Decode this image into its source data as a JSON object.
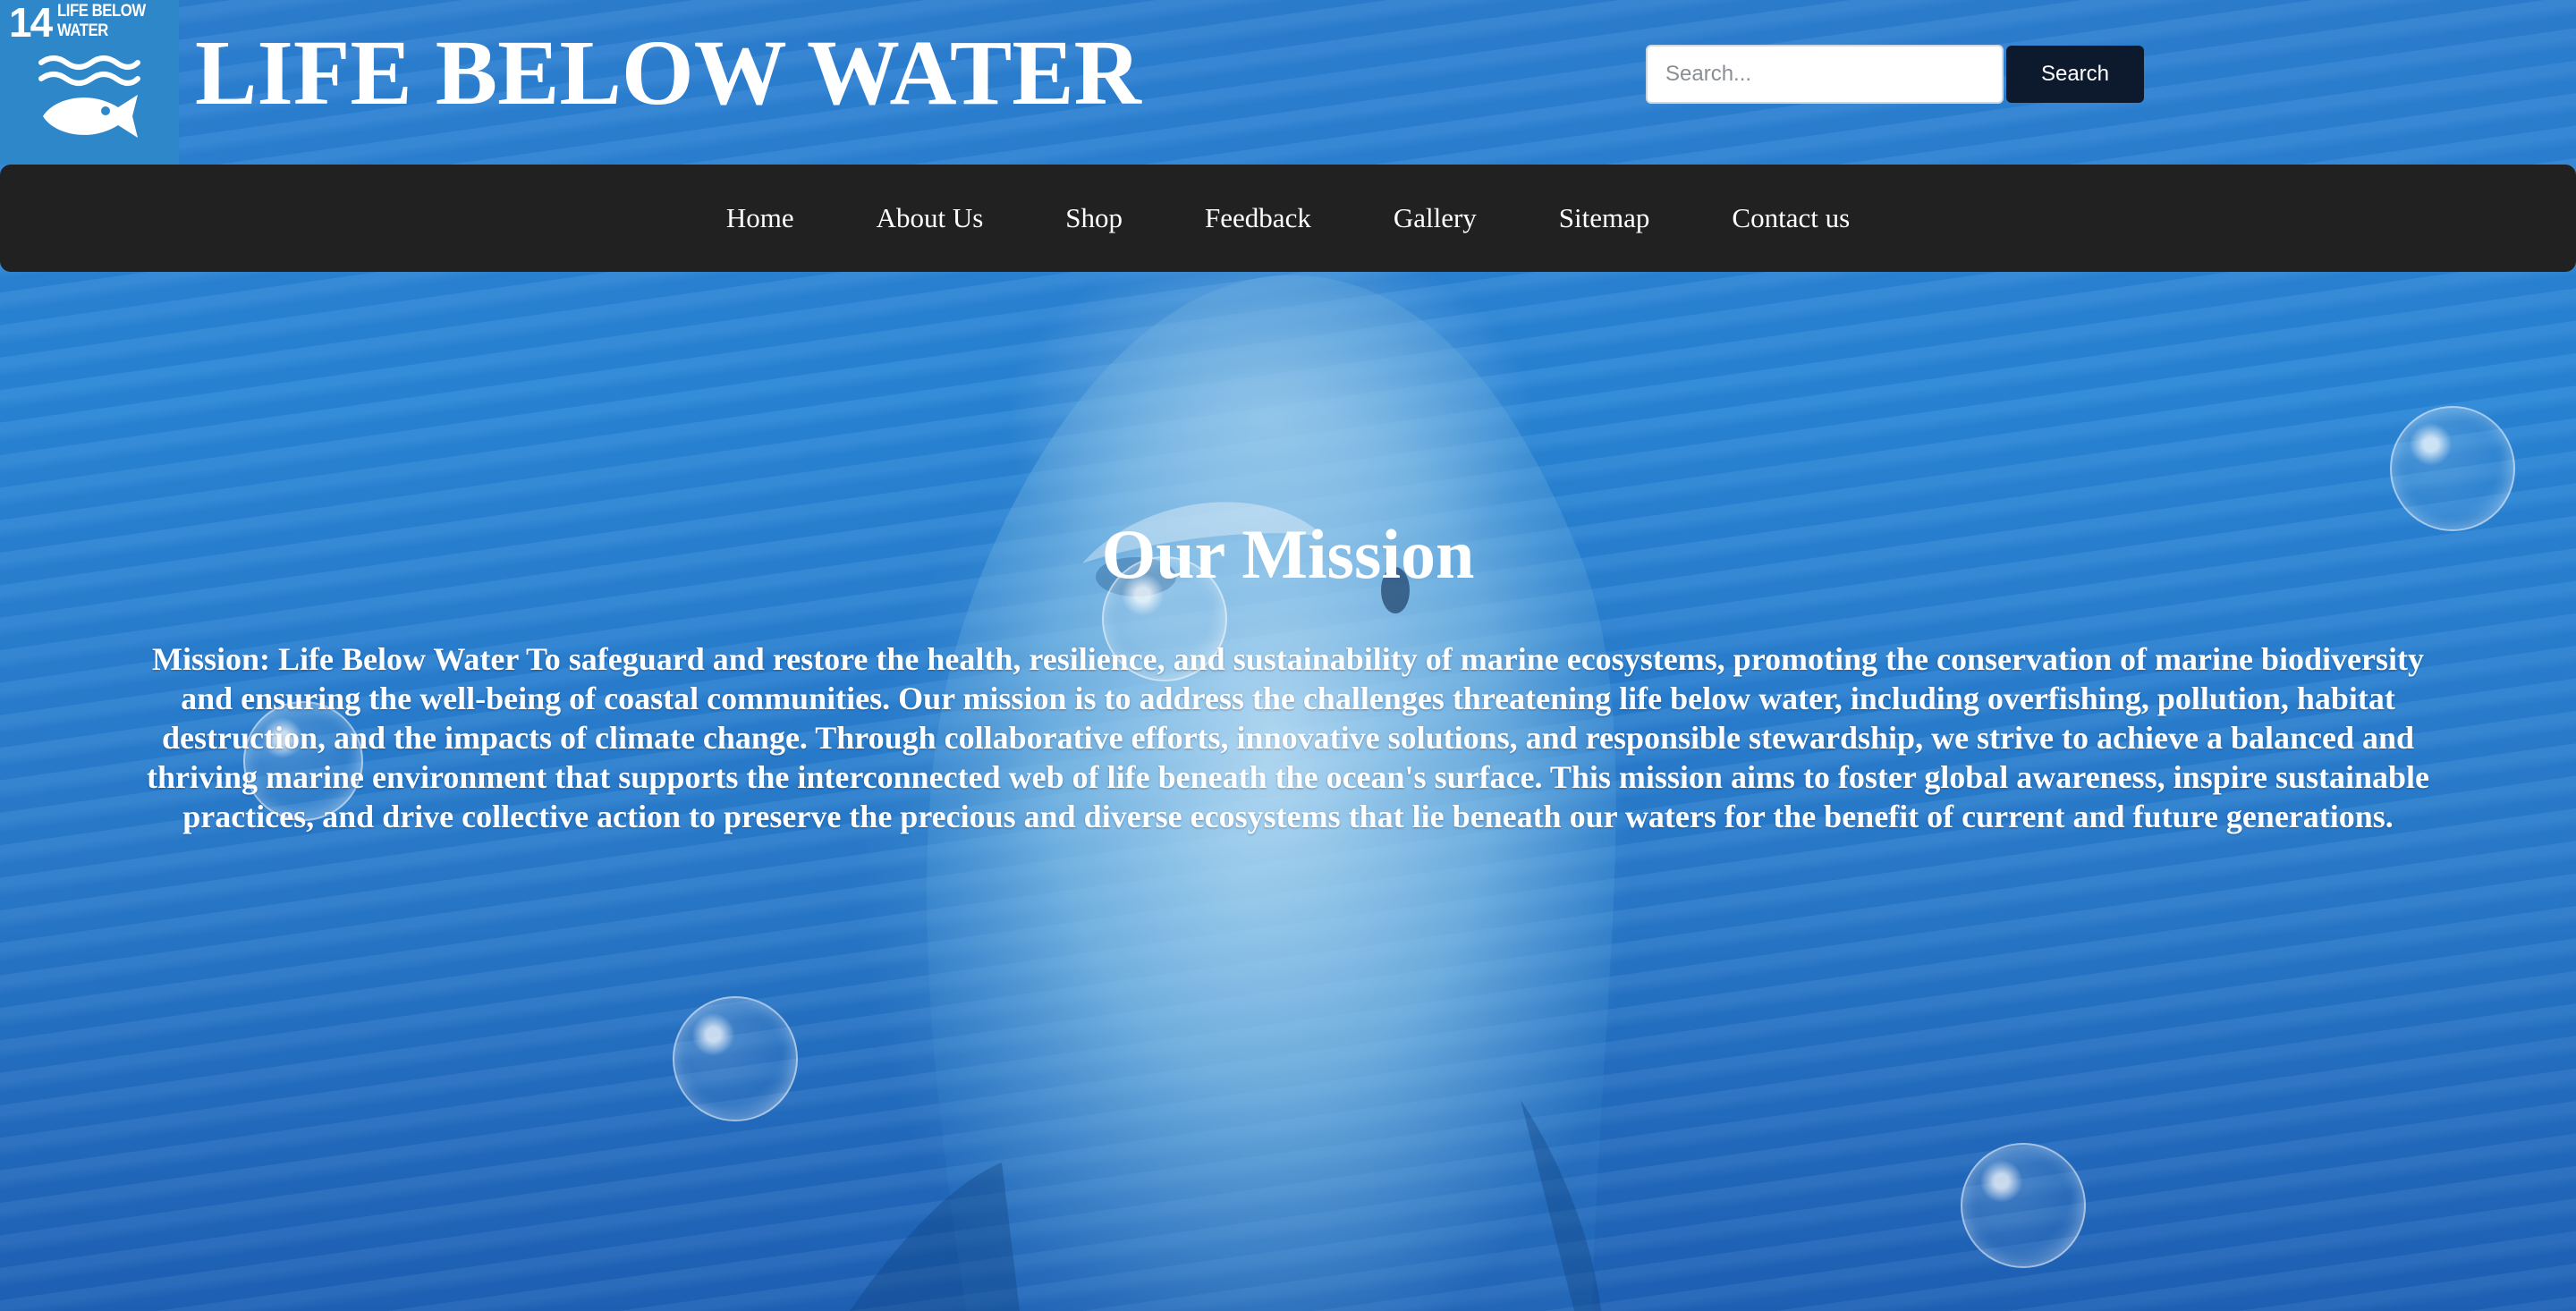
{
  "header": {
    "badge": {
      "number": "14",
      "label": "LIFE BELOW WATER",
      "icon": "fish-waves-icon"
    },
    "title": "LIFE BELOW WATER",
    "search": {
      "placeholder": "Search...",
      "value": "",
      "button_label": "Search"
    }
  },
  "nav": {
    "items": [
      {
        "label": "Home"
      },
      {
        "label": "About Us"
      },
      {
        "label": "Shop"
      },
      {
        "label": "Feedback"
      },
      {
        "label": "Gallery"
      },
      {
        "label": "Sitemap"
      },
      {
        "label": "Contact us"
      }
    ]
  },
  "main": {
    "heading": "Our Mission",
    "body": "Mission: Life Below Water To safeguard and restore the health, resilience, and sustainability of marine ecosystems, promoting the conservation of marine biodiversity and ensuring the well-being of coastal communities. Our mission is to address the challenges threatening life below water, including overfishing, pollution, habitat destruction, and the impacts of climate change. Through collaborative efforts, innovative solutions, and responsible stewardship, we strive to achieve a balanced and thriving marine environment that supports the interconnected web of life beneath the ocean's surface. This mission aims to foster global awareness, inspire sustainable practices, and drive collective action to preserve the precious and diverse ecosystems that lie beneath our waters for the benefit of current and future generations."
  },
  "colors": {
    "ocean": "#2a86d6",
    "badge": "#2e87c8",
    "navbar": "#212121",
    "search_button": "#0d1a2e",
    "text": "#ffffff"
  }
}
